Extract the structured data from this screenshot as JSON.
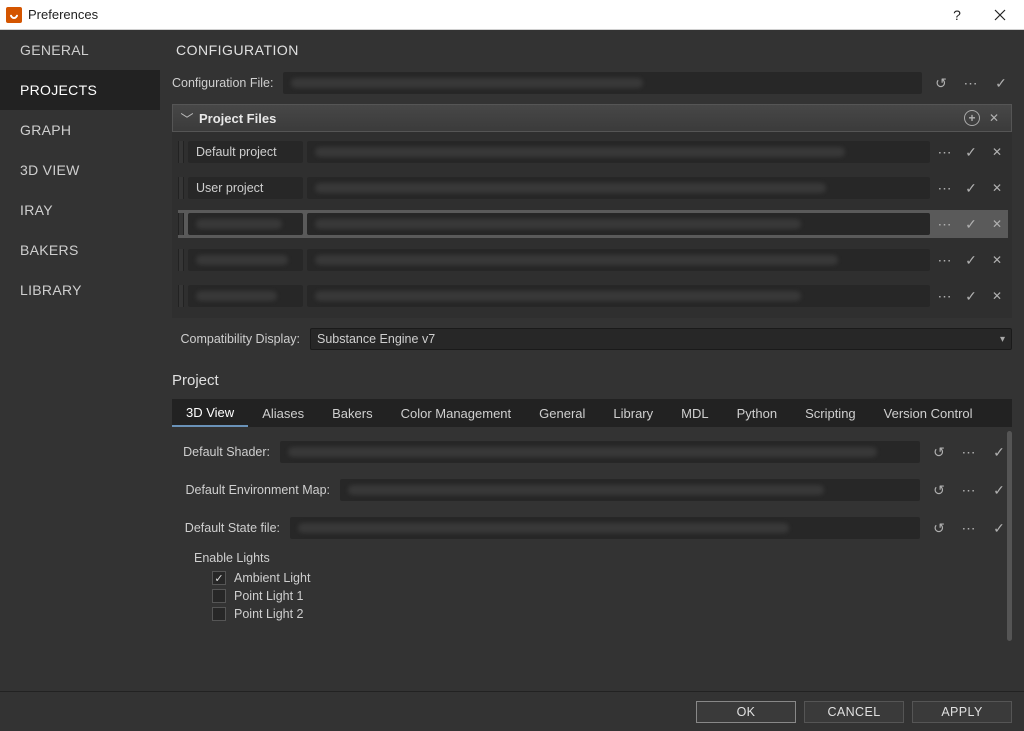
{
  "titlebar": {
    "title": "Preferences"
  },
  "sidebar": {
    "items": [
      {
        "label": "GENERAL",
        "active": false
      },
      {
        "label": "PROJECTS",
        "active": true
      },
      {
        "label": "GRAPH",
        "active": false
      },
      {
        "label": "3D VIEW",
        "active": false
      },
      {
        "label": "IRAY",
        "active": false
      },
      {
        "label": "BAKERS",
        "active": false
      },
      {
        "label": "LIBRARY",
        "active": false
      }
    ]
  },
  "page": {
    "title": "CONFIGURATION",
    "configFile": {
      "label": "Configuration File:"
    },
    "projectFiles": {
      "header": "Project Files",
      "rows": [
        {
          "name": "Default project",
          "selected": false
        },
        {
          "name": "User project",
          "selected": false
        },
        {
          "name": "",
          "selected": true
        },
        {
          "name": "",
          "selected": false
        },
        {
          "name": "",
          "selected": false
        }
      ]
    },
    "compatibility": {
      "label": "Compatibility Display:",
      "value": "Substance Engine v7"
    },
    "projectSection": {
      "title": "Project",
      "tabs": [
        "3D View",
        "Aliases",
        "Bakers",
        "Color Management",
        "General",
        "Library",
        "MDL",
        "Python",
        "Scripting",
        "Version Control"
      ],
      "activeTab": 0,
      "defaultShader": {
        "label": "Default Shader:"
      },
      "defaultEnvMap": {
        "label": "Default Environment Map:"
      },
      "defaultStateFile": {
        "label": "Default State file:"
      },
      "enableLightsTitle": "Enable Lights",
      "lights": [
        {
          "label": "Ambient Light",
          "checked": true
        },
        {
          "label": "Point Light 1",
          "checked": false
        },
        {
          "label": "Point Light 2",
          "checked": false
        }
      ]
    }
  },
  "footer": {
    "ok": "OK",
    "cancel": "CANCEL",
    "apply": "APPLY"
  }
}
